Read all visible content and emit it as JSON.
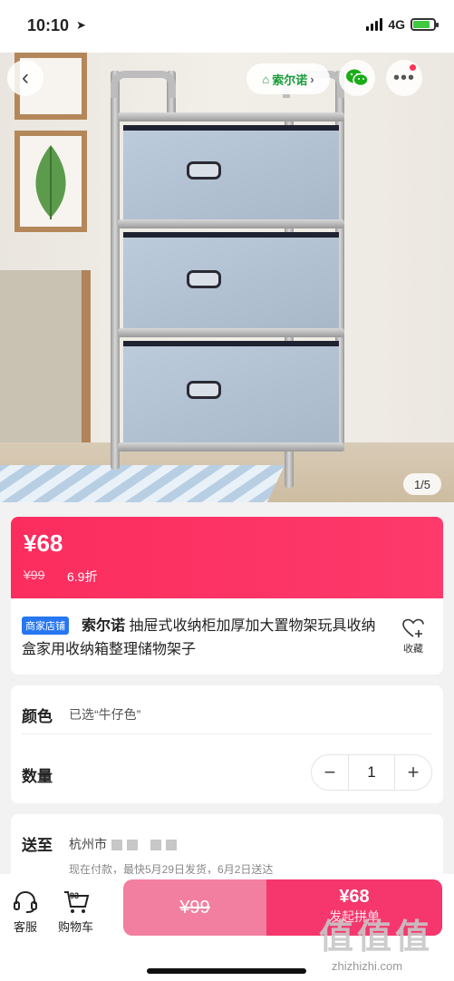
{
  "status": {
    "time": "10:10",
    "network": "4G"
  },
  "gallery": {
    "brand_badge": "索尔诺",
    "counter": "1/5"
  },
  "price": {
    "current": "¥68",
    "original": "¥99",
    "discount": "6.9折"
  },
  "product": {
    "shop_tag": "商家店铺",
    "brand": "索尔诺",
    "title": " 抽屉式收纳柜加厚加大置物架玩具收纳盒家用收纳箱整理储物架子",
    "favorite_label": "收藏"
  },
  "options": {
    "color_label": "颜色",
    "color_value": "已选“牛仔色”",
    "quantity_label": "数量",
    "quantity": "1",
    "minus": "−",
    "plus": "+"
  },
  "shipping": {
    "label": "送至",
    "address": "杭州市",
    "note": "现在付款，最快5月29日发货，6月2日送达"
  },
  "bottom": {
    "service_label": "客服",
    "cart_label": "购物车",
    "cart_count": "93",
    "solo_price": "¥99",
    "group_price": "¥68",
    "group_label": "发起拼单"
  },
  "watermark": {
    "text": "值值值",
    "url": "zhizhizhi.com"
  },
  "colors": {
    "accent": "#fb2d5e",
    "shop_tag": "#2777f0",
    "wechat": "#1aad19"
  }
}
